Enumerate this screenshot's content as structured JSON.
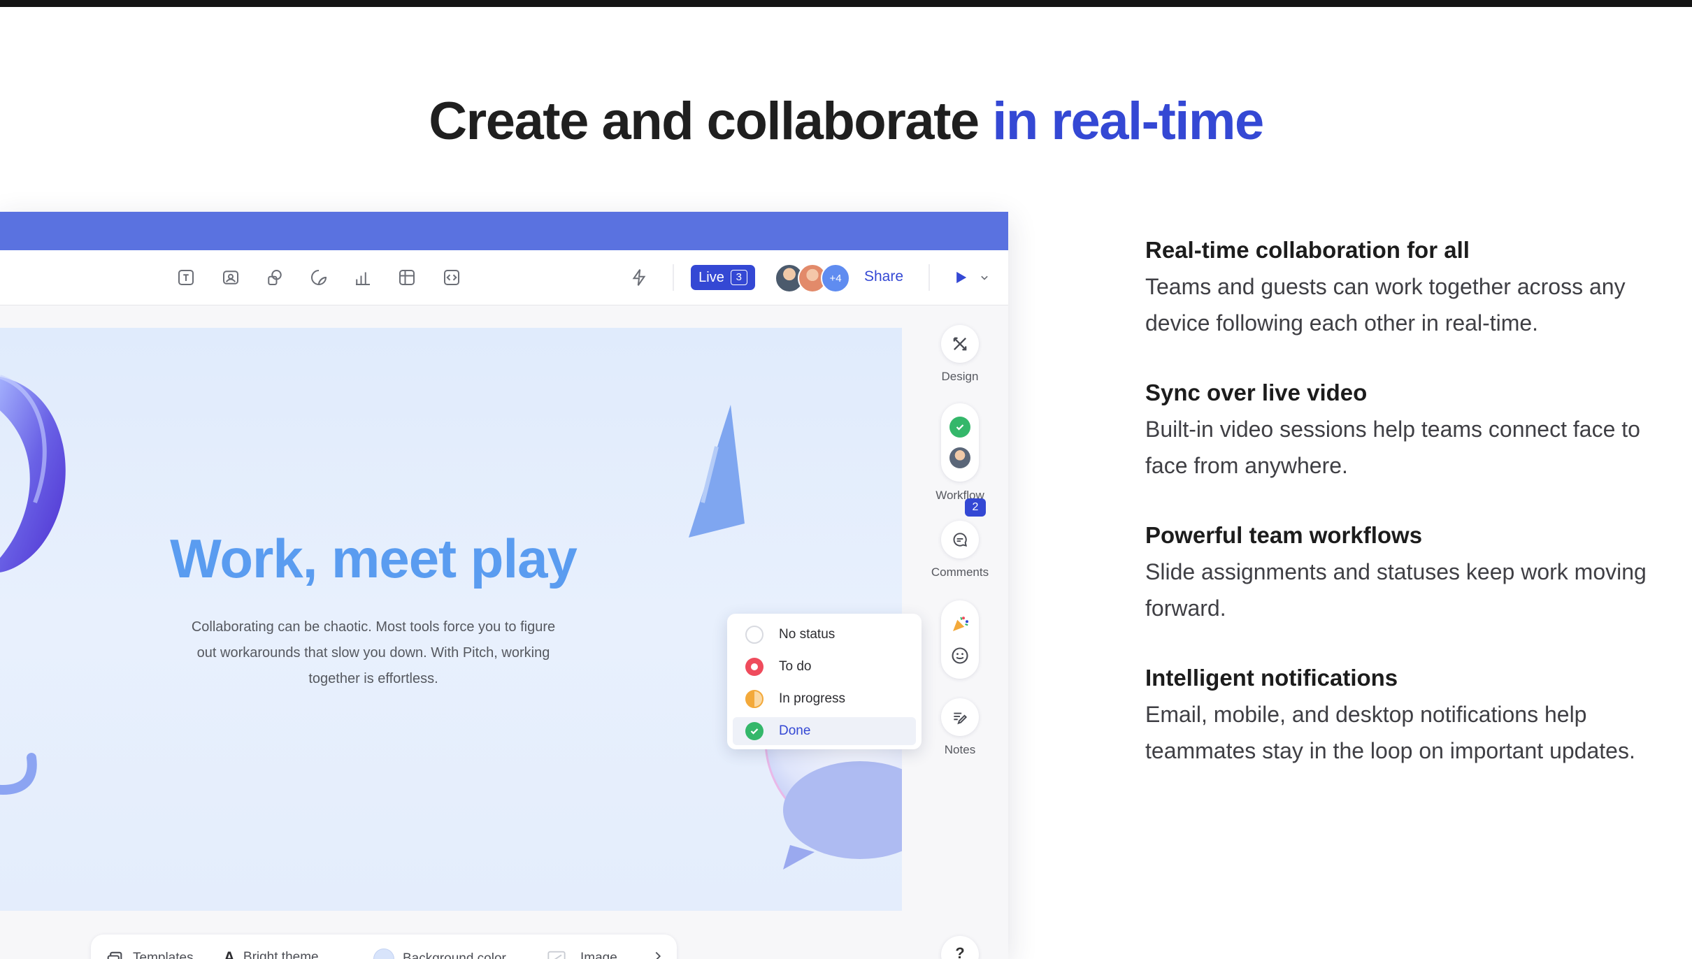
{
  "headline": {
    "main": "Create and collaborate ",
    "accent": "in real-time"
  },
  "toolbar": {
    "icons": [
      "text-icon",
      "image-icon",
      "shapes-icon",
      "sticker-icon",
      "chart-icon",
      "table-icon",
      "embed-icon",
      "lightning-icon"
    ],
    "live_label": "Live",
    "live_count": "3",
    "avatar_more": "+4",
    "share_label": "Share"
  },
  "slide": {
    "title": "Work, meet play",
    "body": "Collaborating can be chaotic. Most tools force you to figure out workarounds that slow you down. With Pitch, working together is effortless."
  },
  "status_menu": {
    "items": [
      {
        "label": "No status",
        "color": "#ffffff"
      },
      {
        "label": "To do",
        "color": "#ef4b5c"
      },
      {
        "label": "In progress",
        "color": "#f3a93a"
      },
      {
        "label": "Done",
        "color": "#34b76a"
      }
    ],
    "selected": "Done"
  },
  "rail": {
    "design": "Design",
    "workflow": "Workflow",
    "comments": "Comments",
    "comments_count": "2",
    "notes": "Notes"
  },
  "bottom_bar": {
    "templates": "Templates",
    "theme": "Bright theme",
    "background": "Background color",
    "image": "Image",
    "help": "?"
  },
  "features": [
    {
      "title": "Real-time collaboration for all",
      "desc": "Teams and guests can work together across any device following each other in real-time."
    },
    {
      "title": "Sync over live video",
      "desc": "Built-in video sessions help teams connect face to face from anywhere."
    },
    {
      "title": "Powerful team workflows",
      "desc": "Slide assignments and statuses keep work moving forward."
    },
    {
      "title": "Intelligent notifications",
      "desc": "Email, mobile, and desktop notifications help teammates stay in the loop on important updates."
    }
  ],
  "colors": {
    "accent": "#3448d4",
    "titlebar": "#5a72e0",
    "slide_title": "#5a9cf0"
  }
}
